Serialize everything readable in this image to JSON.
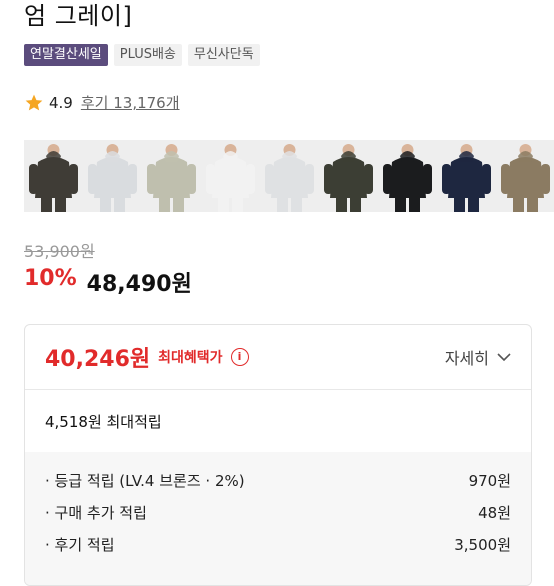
{
  "product": {
    "title_tail": "엄 그레이]"
  },
  "badges": [
    {
      "label": "연말결산세일",
      "type": "sale"
    },
    {
      "label": "PLUS배송",
      "type": "normal"
    },
    {
      "label": "무신사단독",
      "type": "normal"
    }
  ],
  "rating": {
    "score": "4.9",
    "reviews": "후기 13,176개"
  },
  "swatches": [
    {
      "name": "charcoal",
      "color": "#3f3c36"
    },
    {
      "name": "light-gray",
      "color": "#d9dcdf"
    },
    {
      "name": "sage",
      "color": "#bfbfae"
    },
    {
      "name": "white",
      "color": "#f2f2f2"
    },
    {
      "name": "pale-gray",
      "color": "#dfe1e3"
    },
    {
      "name": "olive-dark",
      "color": "#3c3e34"
    },
    {
      "name": "black",
      "color": "#1b1c1e"
    },
    {
      "name": "navy",
      "color": "#1e2740"
    },
    {
      "name": "khaki-model",
      "color": "#8b7b62"
    }
  ],
  "price": {
    "original": "53,900원",
    "discount": "10%",
    "sale": "48,490원"
  },
  "benefit": {
    "max_price": "40,246원",
    "max_label": "최대혜택가",
    "detail_label": "자세히",
    "points_header": "4,518원 최대적립",
    "points": [
      {
        "label": "· 등급 적립 (LV.4 브론즈 · 2%)",
        "value": "970원"
      },
      {
        "label": "· 구매 추가 적립",
        "value": "48원"
      },
      {
        "label": "· 후기 적립",
        "value": "3,500원"
      }
    ]
  },
  "colors": {
    "accent_red": "#e12b2b",
    "sale_badge": "#5b4c7d",
    "star": "#f5a623"
  }
}
